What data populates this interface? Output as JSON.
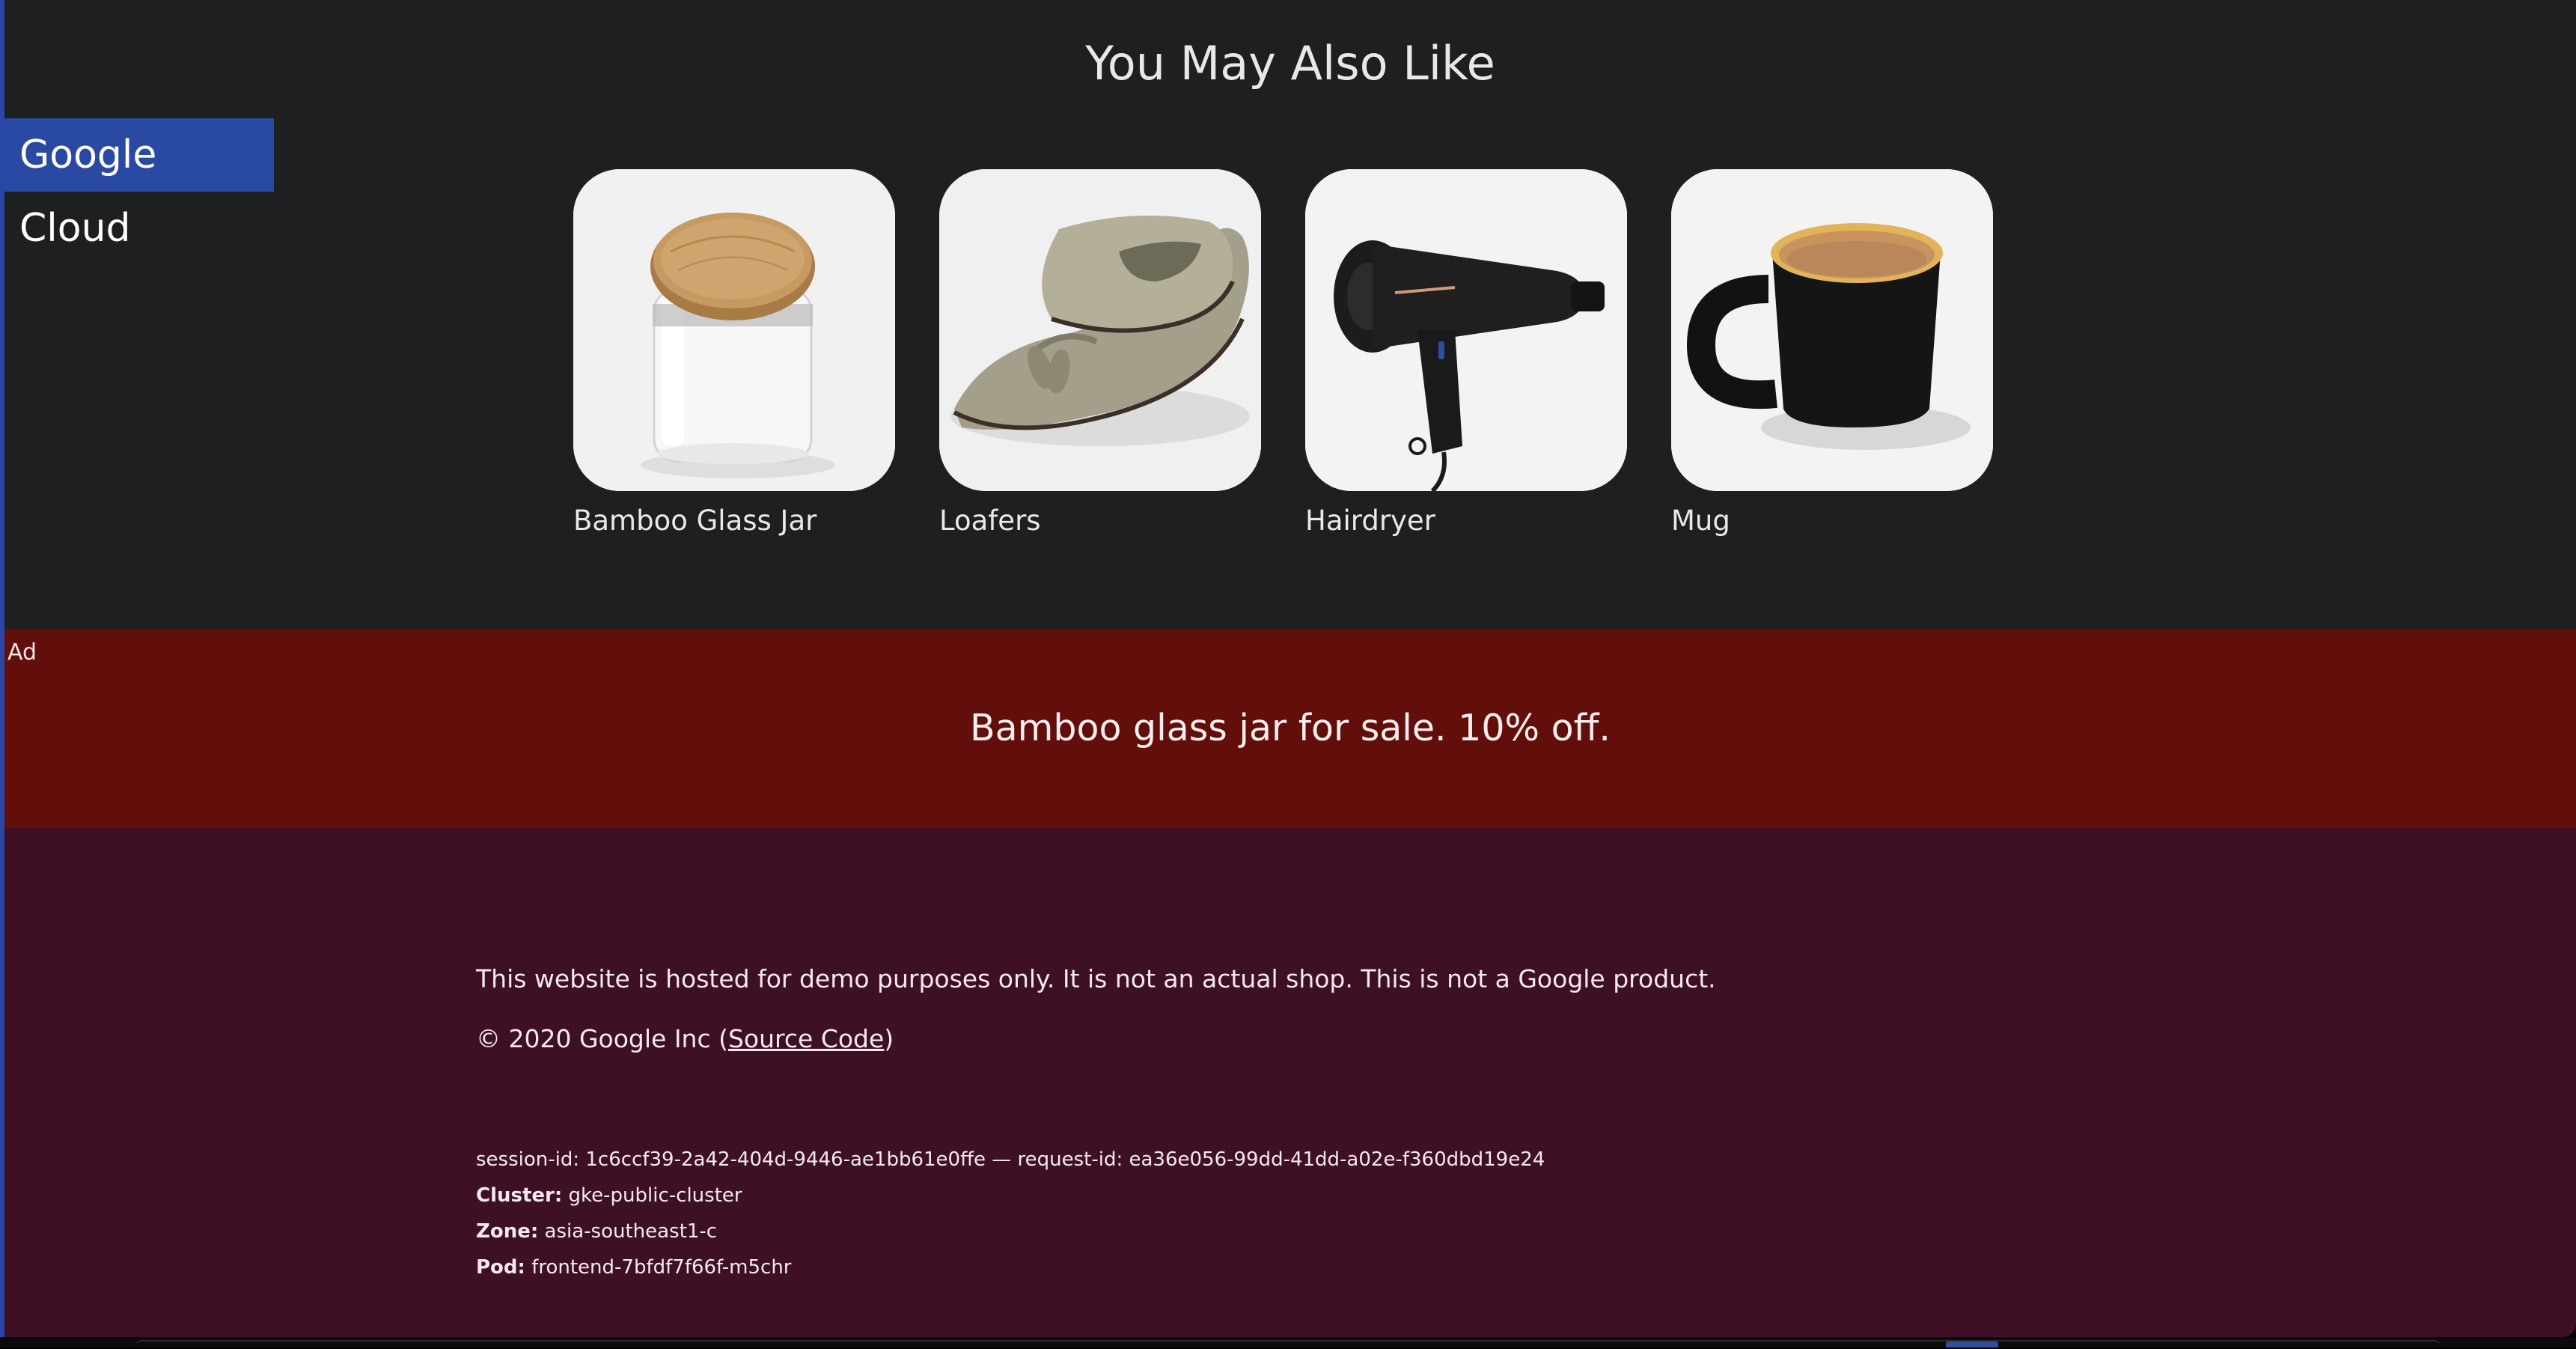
{
  "recommendations": {
    "title": "You May Also Like",
    "products": [
      {
        "name": "Bamboo Glass Jar",
        "image": "bamboo-glass-jar-image"
      },
      {
        "name": "Loafers",
        "image": "loafers-image"
      },
      {
        "name": "Hairdryer",
        "image": "hairdryer-image"
      },
      {
        "name": "Mug",
        "image": "mug-image"
      }
    ]
  },
  "badge": {
    "label": "Google Cloud",
    "color": "#2a49a3"
  },
  "ad": {
    "tag": "Ad",
    "text": "Bamboo glass jar for sale. 10% off.",
    "color": "#620f0b"
  },
  "footer": {
    "disclaimer": "This website is hosted for demo purposes only. It is not an actual shop. This is not a Google product.",
    "copyright_prefix": "© 2020 Google Inc (",
    "source_link": "Source Code",
    "copyright_suffix": ")",
    "session_line": "session-id: 1c6ccf39-2a42-404d-9446-ae1bb61e0ffe — request-id: ea36e056-99dd-41dd-a02e-f360dbd19e24",
    "cluster_label": "Cluster:",
    "cluster_value": "gke-public-cluster",
    "zone_label": "Zone:",
    "zone_value": "asia-southeast1-c",
    "pod_label": "Pod:",
    "pod_value": "frontend-7bfdf7f66f-m5chr",
    "color": "#3e1026"
  },
  "colors": {
    "page_background": "#1e1f21",
    "accent_border": "#2a47a8"
  }
}
